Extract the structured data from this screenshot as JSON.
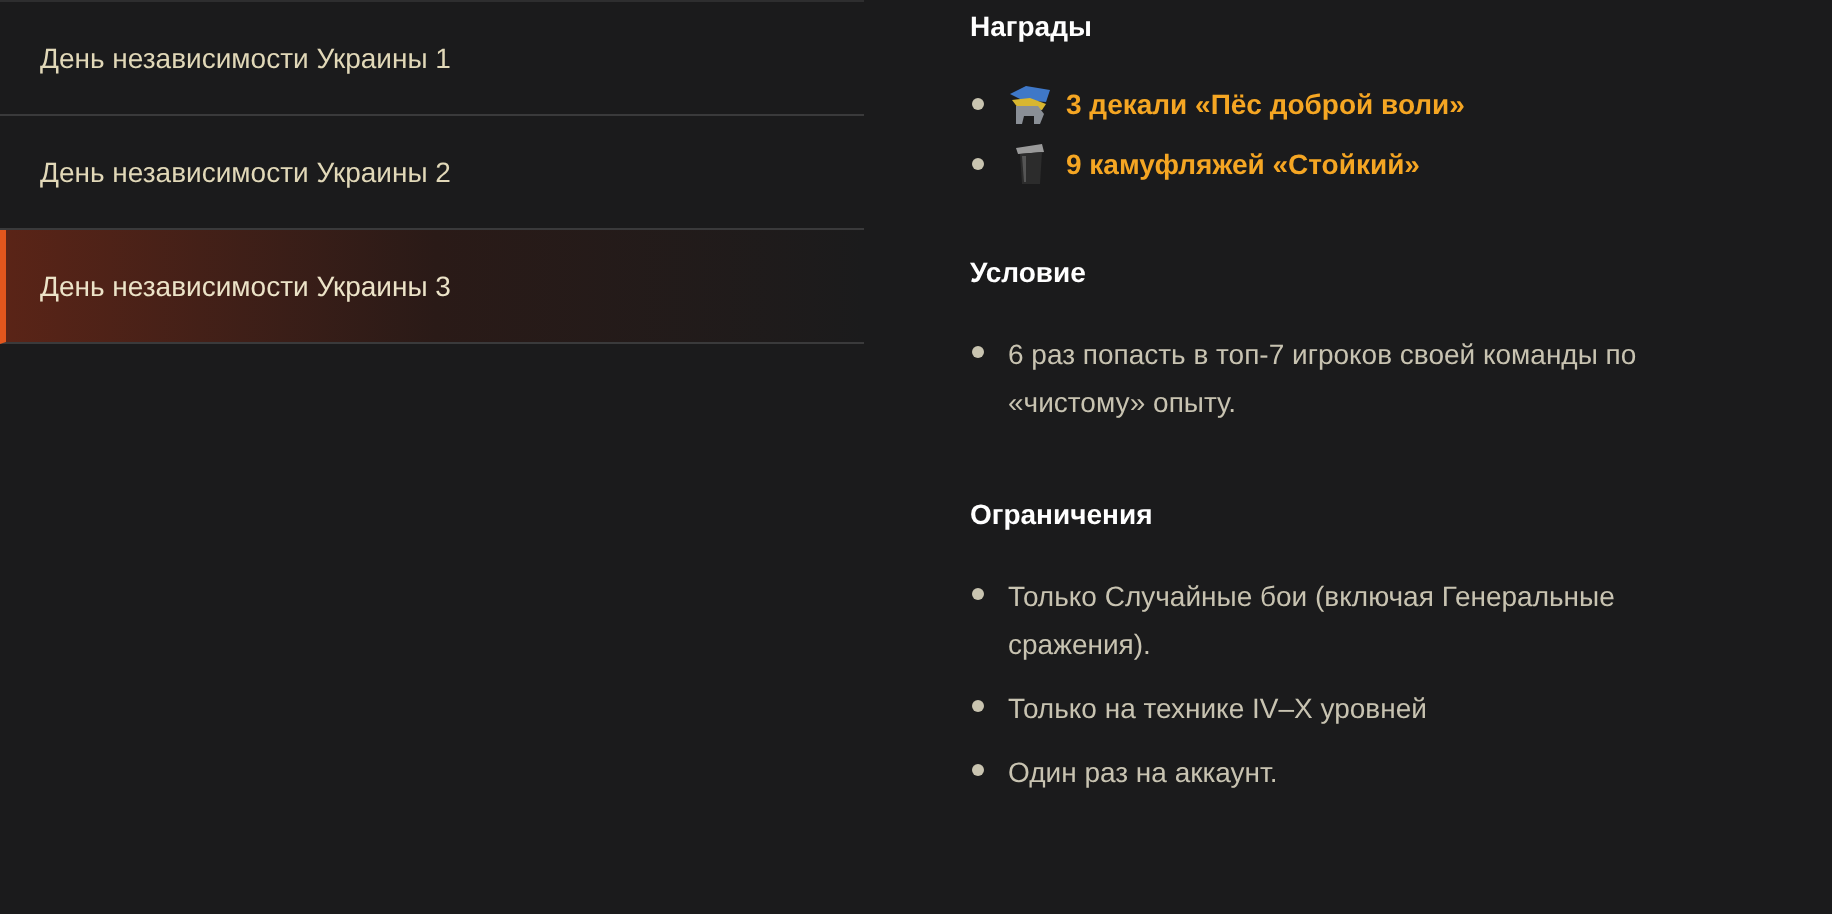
{
  "mission_list": [
    {
      "label": "День независимости Украины 1",
      "selected": false
    },
    {
      "label": "День независимости Украины 2",
      "selected": false
    },
    {
      "label": "День независимости Украины 3",
      "selected": true
    }
  ],
  "sections": [
    {
      "title": "Награды",
      "items": [
        {
          "kind": "reward",
          "text": "3 декали «Пёс доброй воли»"
        },
        {
          "kind": "reward",
          "text": "9 камуфляжей «Стойкий»"
        }
      ]
    },
    {
      "title": "Условие",
      "items": [
        {
          "kind": "text",
          "text": "6 раз попасть в топ-7 игроков своей команды по «чистому» опыту."
        }
      ]
    },
    {
      "title": "Ограничения",
      "items": [
        {
          "kind": "text",
          "text": "Только Случайные бои (включая Генеральные сражения)."
        },
        {
          "kind": "text",
          "text": "Только на технике IV–X уровней"
        },
        {
          "kind": "text",
          "text": "Один раз на аккаунт."
        }
      ]
    }
  ]
}
